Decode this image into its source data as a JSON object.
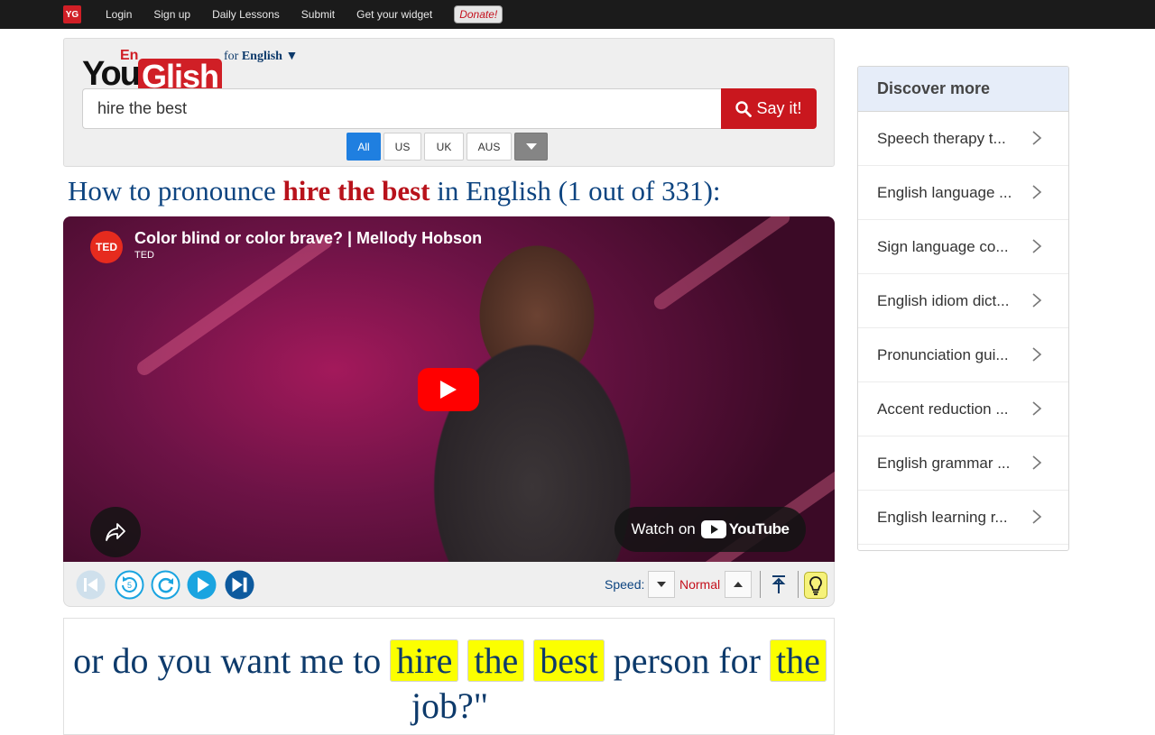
{
  "nav": {
    "badge": "YG",
    "links": [
      "Login",
      "Sign up",
      "Daily Lessons",
      "Submit",
      "Get your widget"
    ],
    "donate": "Donate!"
  },
  "logo": {
    "you": "You",
    "en": "En",
    "glish": "Glish",
    "for_prefix": "for",
    "language": "English ▼"
  },
  "search": {
    "value": "hire the best",
    "button": "Say it!"
  },
  "accents": {
    "items": [
      "All",
      "US",
      "UK",
      "AUS"
    ],
    "selected": "All"
  },
  "heading": {
    "prefix": "How to pronounce",
    "term": "hire the best",
    "suffix": "in English (1 out of 331):"
  },
  "video": {
    "title": "Color blind or color brave? | Mellody Hobson",
    "channel": "TED",
    "channel_logo": "TED",
    "watch_on": "Watch on",
    "youtube": "YouTube"
  },
  "controls": {
    "speed_label": "Speed:",
    "speed_value": "Normal"
  },
  "caption": {
    "words": [
      {
        "t": "or",
        "hl": false
      },
      {
        "t": "do",
        "hl": false
      },
      {
        "t": "you",
        "hl": false
      },
      {
        "t": "want",
        "hl": false
      },
      {
        "t": "me",
        "hl": false
      },
      {
        "t": "to",
        "hl": false
      },
      {
        "t": "hire",
        "hl": true
      },
      {
        "t": "the",
        "hl": true
      },
      {
        "t": "best",
        "hl": true
      },
      {
        "t": "person",
        "hl": false
      },
      {
        "t": "for",
        "hl": false
      },
      {
        "t": "the",
        "hl": true
      },
      {
        "t": "job?\"",
        "hl": false
      }
    ]
  },
  "sidebar": {
    "title": "Discover more",
    "items": [
      "Speech therapy t...",
      "English language ...",
      "Sign language co...",
      "English idiom dict...",
      "Pronunciation gui...",
      "Accent reduction ...",
      "English grammar ...",
      "English learning r..."
    ]
  },
  "colors": {
    "brand_red": "#d01f26",
    "accent_blue": "#0d4480",
    "highlight": "#fbff00"
  }
}
